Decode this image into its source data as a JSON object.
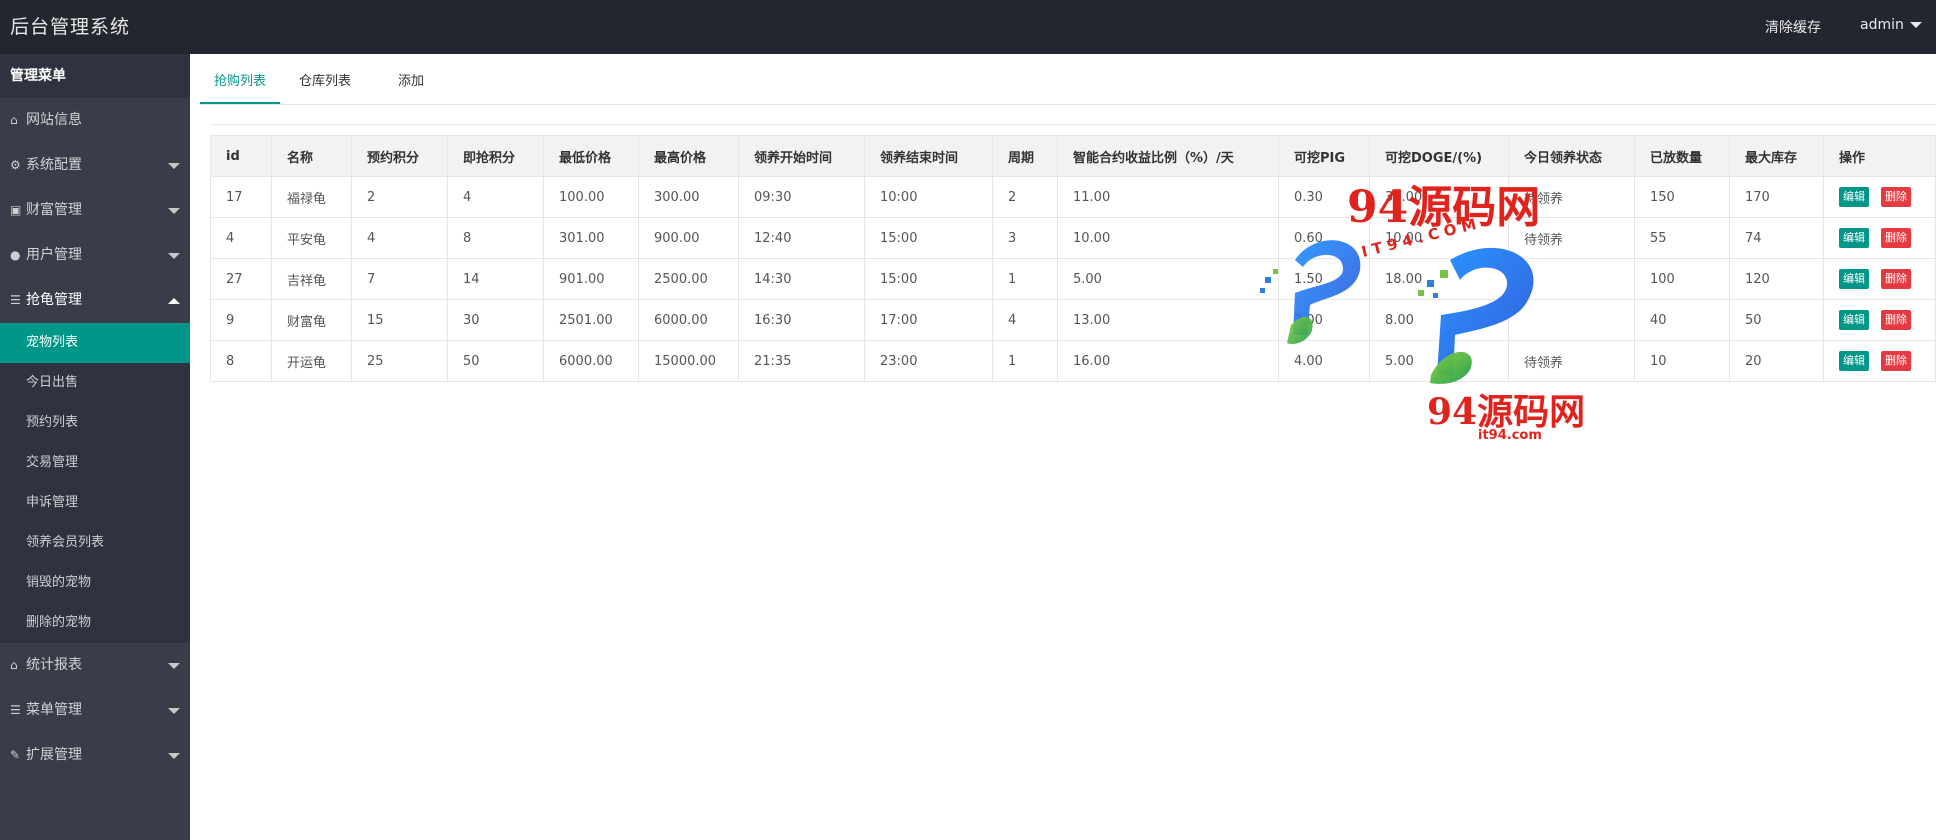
{
  "header": {
    "title": "后台管理系统",
    "clear_cache": "清除缓存",
    "user": "admin"
  },
  "sidebar": {
    "heading": "管理菜单",
    "items": [
      {
        "label": "网站信息",
        "icon": "home-icon"
      },
      {
        "label": "系统配置",
        "icon": "gears-icon"
      },
      {
        "label": "财富管理",
        "icon": "money-icon"
      },
      {
        "label": "用户管理",
        "icon": "users-icon"
      },
      {
        "label": "抢龟管理",
        "icon": "list-icon"
      }
    ],
    "sub_items": [
      "宠物列表",
      "今日出售",
      "预约列表",
      "交易管理",
      "申诉管理",
      "领养会员列表",
      "销毁的宠物",
      "删除的宠物"
    ],
    "bottom_items": [
      {
        "label": "统计报表",
        "icon": "home-icon"
      },
      {
        "label": "菜单管理",
        "icon": "list-icon"
      },
      {
        "label": "扩展管理",
        "icon": "wrench-icon"
      }
    ]
  },
  "tabs": [
    "抢购列表",
    "仓库列表",
    "添加"
  ],
  "table": {
    "headers": [
      "id",
      "名称",
      "预约积分",
      "即抢积分",
      "最低价格",
      "最高价格",
      "领养开始时间",
      "领养结束时间",
      "周期",
      "智能合约收益比例（%）/天",
      "可挖PIG",
      "可挖DOGE/(%)",
      "今日领养状态",
      "已放数量",
      "最大库存",
      "操作"
    ],
    "rows": [
      [
        "17",
        "福禄龟",
        "2",
        "4",
        "100.00",
        "300.00",
        "09:30",
        "10:00",
        "2",
        "11.00",
        "0.30",
        "30.00",
        "待领养",
        "150",
        "170"
      ],
      [
        "4",
        "平安龟",
        "4",
        "8",
        "301.00",
        "900.00",
        "12:40",
        "15:00",
        "3",
        "10.00",
        "0.60",
        "10.00",
        "待领养",
        "55",
        "74"
      ],
      [
        "27",
        "吉祥龟",
        "7",
        "14",
        "901.00",
        "2500.00",
        "14:30",
        "15:00",
        "1",
        "5.00",
        "1.50",
        "18.00",
        "",
        "100",
        "120"
      ],
      [
        "9",
        "财富龟",
        "15",
        "30",
        "2501.00",
        "6000.00",
        "16:30",
        "17:00",
        "4",
        "13.00",
        "3.00",
        "8.00",
        "",
        "40",
        "50"
      ],
      [
        "8",
        "开运龟",
        "25",
        "50",
        "6000.00",
        "15000.00",
        "21:35",
        "23:00",
        "1",
        "16.00",
        "4.00",
        "5.00",
        "待领养",
        "10",
        "20"
      ]
    ],
    "edit_label": "编辑",
    "delete_label": "删除"
  },
  "watermark": {
    "top_text": "94源码网",
    "dots_text": "I T 9 4 . C O M",
    "bottom_text": "94源码网",
    "url": "it94.com"
  },
  "colors": {
    "header_bg": "#23262e",
    "sidebar_bg": "#393d49",
    "accent": "#009688",
    "danger": "#e63a42",
    "watermark_red": "#e0231d"
  }
}
